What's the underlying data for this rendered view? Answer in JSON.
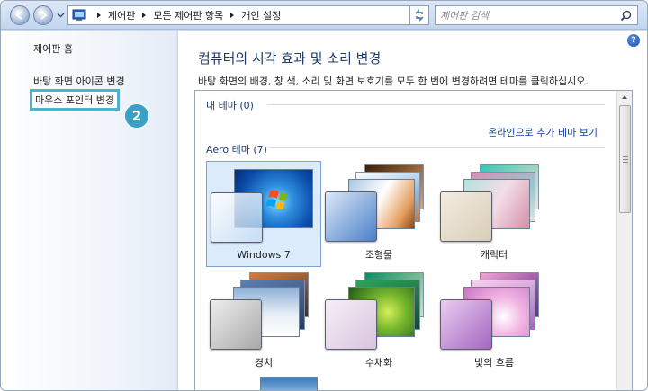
{
  "addressbar": {
    "crumbs": [
      "제어판",
      "모든 제어판 항목",
      "개인 설정"
    ],
    "search_placeholder": "제어판 검색"
  },
  "leftpane": {
    "home": "제어판 홈",
    "desktop_icons": "바탕 화면 아이콘 변경",
    "mouse_pointer": "마우스 포인터 변경",
    "step_badge": "2"
  },
  "main": {
    "title": "컴퓨터의 시각 효과 및 소리 변경",
    "description": "바탕 화면의 배경, 창 색, 소리 및 화면 보호기를 모두 한 번에 변경하려면 테마를 클릭하십시오.",
    "my_themes": "내 테마 (0)",
    "online_link": "온라인으로 추가 테마 보기",
    "aero_themes": "Aero 테마 (7)",
    "themes": [
      {
        "label": "Windows 7",
        "selected": true
      },
      {
        "label": "조형물",
        "selected": false
      },
      {
        "label": "캐릭터",
        "selected": false
      },
      {
        "label": "경치",
        "selected": false
      },
      {
        "label": "수채화",
        "selected": false
      },
      {
        "label": "빛의 흐름",
        "selected": false
      }
    ]
  },
  "colors": {
    "accent": "#3aa1c4",
    "link": "#0a3fa6",
    "title": "#1e3a6e"
  }
}
